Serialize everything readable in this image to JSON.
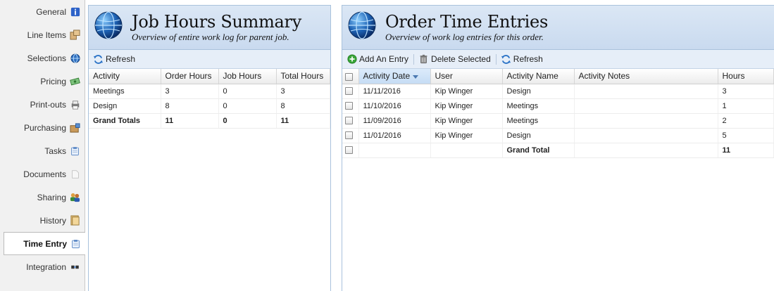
{
  "sidebar": {
    "items": [
      {
        "label": "General",
        "icon": "info-icon"
      },
      {
        "label": "Line Items",
        "icon": "boxes-icon"
      },
      {
        "label": "Selections",
        "icon": "globe-icon"
      },
      {
        "label": "Pricing",
        "icon": "money-icon"
      },
      {
        "label": "Print-outs",
        "icon": "printer-icon"
      },
      {
        "label": "Purchasing",
        "icon": "package-icon"
      },
      {
        "label": "Tasks",
        "icon": "clipboard-icon"
      },
      {
        "label": "Documents",
        "icon": "document-icon"
      },
      {
        "label": "Sharing",
        "icon": "users-icon"
      },
      {
        "label": "History",
        "icon": "folder-icon"
      },
      {
        "label": "Time Entry",
        "icon": "clipboard-icon",
        "active": true
      },
      {
        "label": "Integration",
        "icon": "plugin-icon"
      }
    ]
  },
  "left_panel": {
    "title": "Job Hours Summary",
    "subtitle": "Overview of entire work log for parent job.",
    "toolbar": {
      "refresh": "Refresh"
    },
    "columns": [
      "Activity",
      "Order Hours",
      "Job Hours",
      "Total Hours"
    ],
    "rows": [
      [
        "Meetings",
        "3",
        "0",
        "3"
      ],
      [
        "Design",
        "8",
        "0",
        "8"
      ]
    ],
    "totals": [
      "Grand Totals",
      "11",
      "0",
      "11"
    ]
  },
  "right_panel": {
    "title": "Order Time Entries",
    "subtitle": "Overview of work log entries for this order.",
    "toolbar": {
      "add": "Add An Entry",
      "delete": "Delete Selected",
      "refresh": "Refresh"
    },
    "columns": [
      "Activity Date",
      "User",
      "Activity Name",
      "Activity Notes",
      "Hours"
    ],
    "rows": [
      [
        "11/11/2016",
        "Kip Winger",
        "Design",
        "",
        "3"
      ],
      [
        "11/10/2016",
        "Kip Winger",
        "Meetings",
        "",
        "1"
      ],
      [
        "11/09/2016",
        "Kip Winger",
        "Meetings",
        "",
        "2"
      ],
      [
        "11/01/2016",
        "Kip Winger",
        "Design",
        "",
        "5"
      ]
    ],
    "totals": {
      "label": "Grand Total",
      "hours": "11"
    }
  },
  "colors": {
    "header_bg": "#c9daef",
    "border": "#a9c2dc",
    "accent": "#3b6fb0"
  }
}
